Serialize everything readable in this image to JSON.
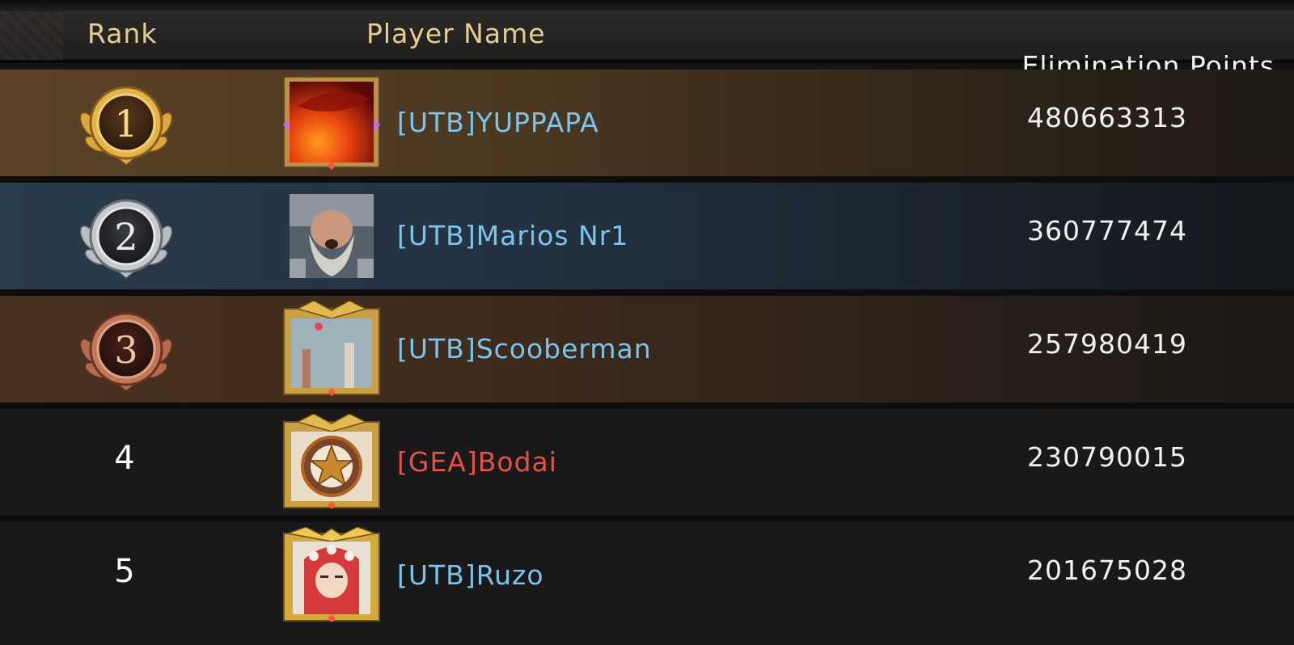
{
  "header": {
    "rank_label": "Rank",
    "name_label": "Player Name",
    "points_label": "Elimination Points"
  },
  "rows": [
    {
      "rank": "1",
      "name": "[UTB]YUPPAPA",
      "points": "480663313",
      "medal": "gold-medal-icon",
      "avatar": "fire-portrait-avatar"
    },
    {
      "rank": "2",
      "name": "[UTB]Marios Nr1",
      "points": "360777474",
      "medal": "silver-medal-icon",
      "avatar": "bearded-warrior-avatar"
    },
    {
      "rank": "3",
      "name": "[UTB]Scooberman",
      "points": "257980419",
      "medal": "bronze-medal-icon",
      "avatar": "raised-hands-avatar"
    },
    {
      "rank": "4",
      "name": "[GEA]Bodai",
      "points": "230790015",
      "avatar": "star-emblem-avatar"
    },
    {
      "rank": "5",
      "name": "[UTB]Ruzo",
      "points": "201675028",
      "avatar": "red-hooded-character-avatar"
    }
  ],
  "colors": {
    "header_text": "#e6cd93",
    "alliance_friendly": "#7cc4ee",
    "alliance_enemy": "#e25247",
    "gold": "#d9a93f",
    "silver": "#b9bcc1",
    "bronze": "#b56a4e"
  }
}
